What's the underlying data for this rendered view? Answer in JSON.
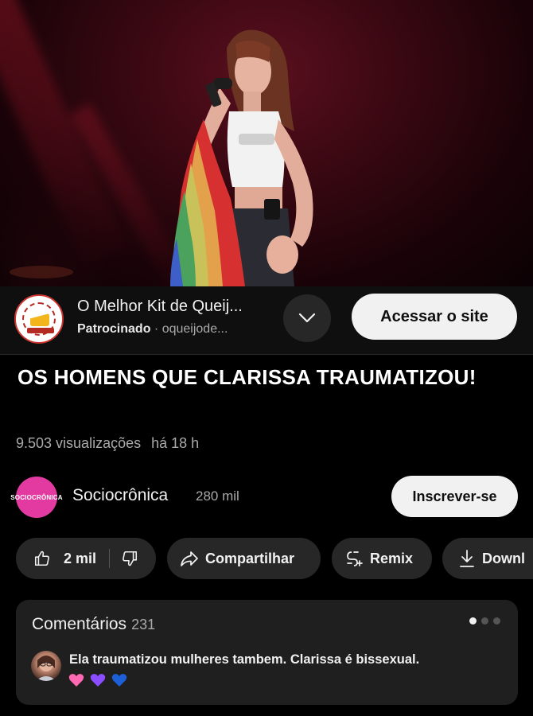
{
  "ad": {
    "title": "O Melhor Kit de Queij...",
    "sponsored_label": "Patrocinado",
    "separator": "·",
    "domain": "oqueijode...",
    "cta_label": "Acessar o site",
    "logo_icon": "cheese-logo-icon"
  },
  "video": {
    "title": "OS HOMENS QUE CLARISSA TRAUMATIZOU!",
    "views": "9.503 visualizações",
    "age": "há 18 h"
  },
  "channel": {
    "avatar_text": "SOCIOCRÔNICA",
    "name": "Sociocrônica",
    "subscribers": "280 mil",
    "subscribe_label": "Inscrever-se",
    "avatar_color": "#e23aa0"
  },
  "actions": {
    "like_count": "2 mil",
    "share_label": "Compartilhar",
    "remix_label": "Remix",
    "download_label": "Downl"
  },
  "comments": {
    "label": "Comentários",
    "count": "231",
    "top_comment": "Ela traumatizou mulheres tambem.   Clarissa é bissexual.",
    "heart_colors": [
      "#ff69b4",
      "#8a4dff",
      "#1c5fd6"
    ],
    "pages": 3,
    "active_page": 1
  }
}
